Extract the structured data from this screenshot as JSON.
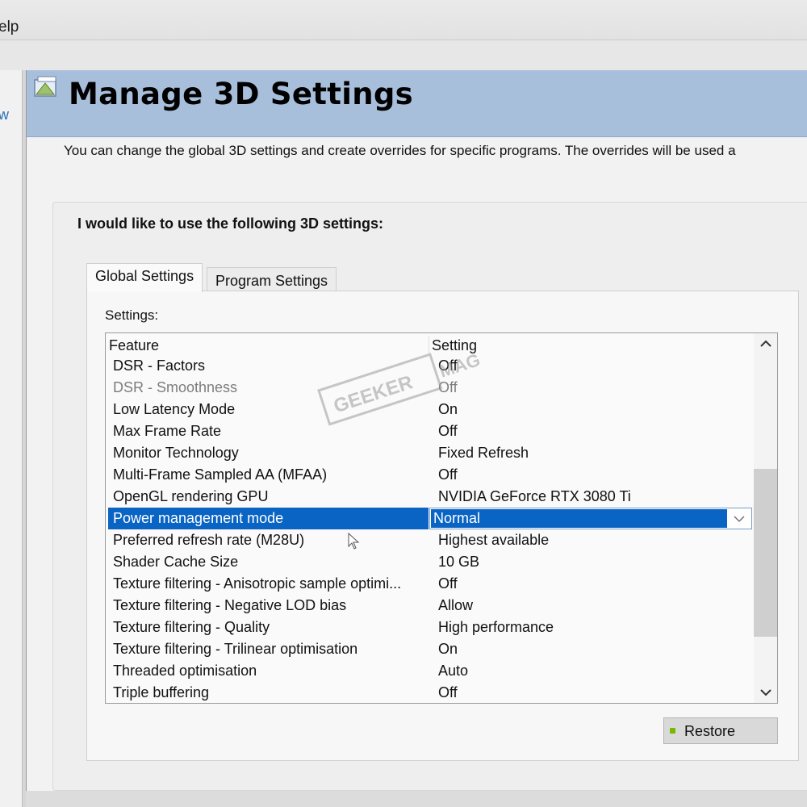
{
  "menubar": {
    "help_label": "elp"
  },
  "sidebar": {
    "link_fragment": "w"
  },
  "header": {
    "title": "Manage 3D Settings"
  },
  "description": "You can change the global 3D settings and create overrides for specific programs. The overrides will be used a",
  "group": {
    "heading": "I would like to use the following 3D settings:"
  },
  "tabs": [
    {
      "label": "Global Settings",
      "active": true
    },
    {
      "label": "Program Settings",
      "active": false
    }
  ],
  "settings_label": "Settings:",
  "table": {
    "columns": [
      "Feature",
      "Setting"
    ],
    "rows": [
      {
        "feature": "DSR - Factors",
        "setting": "Off"
      },
      {
        "feature": "DSR - Smoothness",
        "setting": "Off",
        "disabled": true
      },
      {
        "feature": "Low Latency Mode",
        "setting": "On"
      },
      {
        "feature": "Max Frame Rate",
        "setting": "Off"
      },
      {
        "feature": "Monitor Technology",
        "setting": "Fixed Refresh"
      },
      {
        "feature": "Multi-Frame Sampled AA (MFAA)",
        "setting": "Off"
      },
      {
        "feature": "OpenGL rendering GPU",
        "setting": "NVIDIA GeForce RTX 3080 Ti"
      },
      {
        "feature": "Power management mode",
        "setting": "Normal",
        "selected": true
      },
      {
        "feature": "Preferred refresh rate (M28U)",
        "setting": "Highest available"
      },
      {
        "feature": "Shader Cache Size",
        "setting": "10 GB"
      },
      {
        "feature": "Texture filtering - Anisotropic sample optimi...",
        "setting": "Off"
      },
      {
        "feature": "Texture filtering - Negative LOD bias",
        "setting": "Allow"
      },
      {
        "feature": "Texture filtering - Quality",
        "setting": "High performance"
      },
      {
        "feature": "Texture filtering - Trilinear optimisation",
        "setting": "On"
      },
      {
        "feature": "Threaded optimisation",
        "setting": "Auto"
      },
      {
        "feature": "Triple buffering",
        "setting": "Off"
      }
    ]
  },
  "buttons": {
    "restore": "Restore"
  },
  "watermark": {
    "text1": "GEEKER",
    "text2": "MAG"
  },
  "colors": {
    "selection": "#0a64c4",
    "header_band": "#a8bfdc",
    "nvidia_green": "#76b900"
  }
}
